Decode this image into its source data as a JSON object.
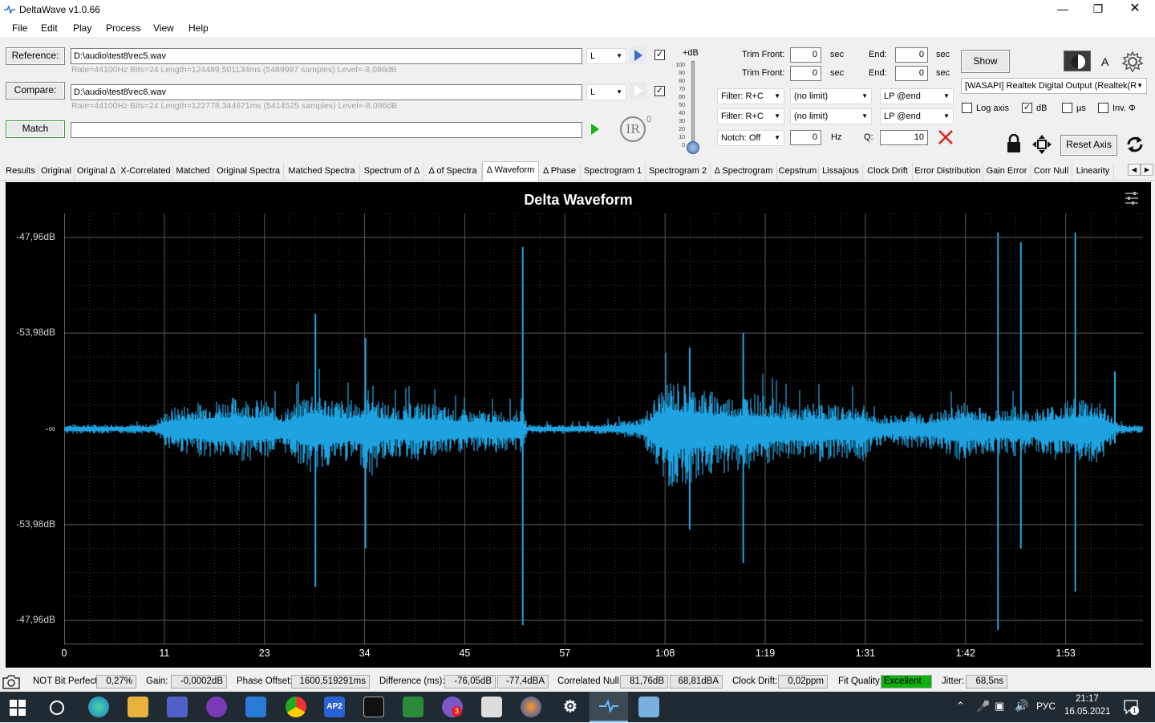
{
  "window": {
    "title": "DeltaWave v1.0.66"
  },
  "menu": [
    "File",
    "Edit",
    "Play",
    "Process",
    "View",
    "Help"
  ],
  "reference": {
    "button": "Reference:",
    "path": "D:\\audio\\test8\\rec5.wav",
    "info": "Rate=44100Hz Bits=24 Length=124489,501134ms (5489987 samples) Level=-8,086dB",
    "channel": "L"
  },
  "compare": {
    "button": "Compare:",
    "path": "D:\\audio\\test8\\rec6.wav",
    "info": "Rate=44100Hz Bits=24 Length=122778,344671ms (5414525 samples) Level=-8,086dB",
    "channel": "L"
  },
  "match": {
    "button": "Match",
    "value": ""
  },
  "ir_label": "IR",
  "ir_sup": "0",
  "level": {
    "label": "+dB",
    "ticks": [
      "100",
      "90",
      "80",
      "70",
      "60",
      "50",
      "40",
      "30",
      "20",
      "10",
      "0"
    ],
    "value": 0
  },
  "trim": {
    "front_label": "Trim Front:",
    "end_label": "End:",
    "unit": "sec",
    "ref_front": "0",
    "ref_end": "0",
    "cmp_front": "0",
    "cmp_end": "0"
  },
  "filters": {
    "filter1": "Filter: R+C",
    "limit1": "(no limit)",
    "lp1": "LP @end",
    "filter2": "Filter: R+C",
    "limit2": "(no limit)",
    "lp2": "LP @end",
    "notch": "Notch: Off",
    "notch_hz": "0",
    "hz_label": "Hz",
    "q_label": "Q:",
    "q_value": "10"
  },
  "output": {
    "show_button": "Show",
    "a_label": "A",
    "device": "[WASAPI] Realtek Digital Output (Realtek(R",
    "log_axis": {
      "label": "Log axis",
      "checked": false
    },
    "db": {
      "label": "dB",
      "checked": true
    },
    "us": {
      "label": "µs",
      "checked": false
    },
    "inv": {
      "label": "Inv. Φ",
      "checked": false
    },
    "reset_axis": "Reset Axis"
  },
  "tabs": [
    "Results",
    "Original",
    "Original Δ",
    "X-Correlated",
    "Matched",
    "Original Spectra",
    "Matched Spectra",
    "Spectrum of Δ",
    "Δ of Spectra",
    "Δ Waveform",
    "Δ Phase",
    "Spectrogram 1",
    "Spectrogram 2",
    "Δ Spectrogram",
    "Cepstrum",
    "Lissajous",
    "Clock Drift",
    "Error Distribution",
    "Gain Error",
    "Corr Null",
    "Linearity"
  ],
  "active_tab": "Δ Waveform",
  "chart_data": {
    "type": "line",
    "title": "Delta Waveform",
    "xlabel": "",
    "ylabel": "",
    "x_tick_labels": [
      "0",
      "11",
      "23",
      "34",
      "45",
      "57",
      "1:08",
      "1:19",
      "1:31",
      "1:42",
      "1:53"
    ],
    "x_ticks_seconds": [
      0,
      11.4,
      22.8,
      34.2,
      45.6,
      57,
      68.4,
      79.8,
      91.2,
      102.6,
      114
    ],
    "xlim_seconds": [
      0,
      122.8
    ],
    "y_tick_labels": [
      "-47,96dB",
      "-53,98dB",
      "-∞",
      "-53,98dB",
      "-47,96dB"
    ],
    "y_ticks_linear": [
      0.004,
      0.002,
      0,
      -0.002,
      -0.004
    ],
    "ylim_linear": [
      -0.0045,
      0.0045
    ],
    "grid": true,
    "series": [
      {
        "color": "#1fa3e0",
        "envelope_time_s": [
          0,
          5,
          10,
          11.8,
          13,
          16,
          20,
          23,
          25,
          26.5,
          28,
          29,
          30,
          32,
          34,
          35,
          36,
          38,
          40,
          43,
          46,
          48,
          50,
          52.3,
          52.7,
          53.5,
          56,
          60,
          65,
          66,
          67,
          68,
          69,
          70,
          72,
          74,
          76,
          78,
          80,
          82,
          84,
          86,
          88,
          91,
          92,
          94,
          96,
          98,
          100,
          102,
          104,
          106,
          108,
          110,
          112,
          114,
          116,
          118,
          120,
          122.8
        ],
        "envelope_upper": [
          0.0001,
          0.0001,
          0.0001,
          0.0004,
          0.0005,
          0.0006,
          0.0007,
          0.0006,
          0.0004,
          0.0006,
          0.0009,
          0.0008,
          0.0007,
          0.0006,
          0.0007,
          0.001,
          0.0006,
          0.0005,
          0.0006,
          0.0005,
          0.0004,
          0.0004,
          0.0004,
          0.0004,
          0.0001,
          0.0001,
          0.0001,
          0.0001,
          0.0002,
          0.0003,
          0.0006,
          0.0009,
          0.0011,
          0.001,
          0.0009,
          0.0008,
          0.0007,
          0.0008,
          0.0007,
          0.0006,
          0.0005,
          0.0006,
          0.0005,
          0.0006,
          0.0003,
          0.0003,
          0.0004,
          0.0003,
          0.0004,
          0.0006,
          0.0005,
          0.0004,
          0.0005,
          0.0004,
          0.0005,
          0.0006,
          0.0007,
          0.0006,
          0.0001,
          0.0001
        ],
        "envelope_lower": [
          -0.0001,
          -0.0001,
          -0.0001,
          -0.0004,
          -0.0005,
          -0.0006,
          -0.0007,
          -0.0006,
          -0.0005,
          -0.0007,
          -0.001,
          -0.0009,
          -0.0008,
          -0.0007,
          -0.0008,
          -0.0011,
          -0.0007,
          -0.0006,
          -0.0007,
          -0.0006,
          -0.0005,
          -0.0005,
          -0.0005,
          -0.0005,
          -0.0001,
          -0.0001,
          -0.0001,
          -0.0001,
          -0.0002,
          -0.0003,
          -0.0008,
          -0.0011,
          -0.0013,
          -0.0012,
          -0.0011,
          -0.001,
          -0.0009,
          -0.0009,
          -0.0008,
          -0.0007,
          -0.0006,
          -0.0007,
          -0.0006,
          -0.0007,
          -0.0004,
          -0.0003,
          -0.0004,
          -0.0004,
          -0.0005,
          -0.0007,
          -0.0006,
          -0.0005,
          -0.0006,
          -0.0005,
          -0.0006,
          -0.0007,
          -0.0008,
          -0.0007,
          -0.0001,
          -0.0001
        ],
        "spikes": [
          {
            "t": 28.6,
            "max": 0.0024,
            "min": -0.0033
          },
          {
            "t": 34.3,
            "max": 0.0019,
            "min": -0.0025
          },
          {
            "t": 52.2,
            "max": 0.0038,
            "min": -0.0041
          },
          {
            "t": 71.2,
            "max": 0.0017,
            "min": -0.0021
          },
          {
            "t": 77.3,
            "max": 0.002,
            "min": -0.0028
          },
          {
            "t": 106.3,
            "max": 0.0041,
            "min": -0.0042
          },
          {
            "t": 108.9,
            "max": 0.0039,
            "min": -0.0025
          },
          {
            "t": 115.1,
            "max": 0.0041,
            "min": -0.0034
          },
          {
            "t": 119.6,
            "max": 0.0012,
            "min": -0.0003
          }
        ]
      }
    ]
  },
  "status": {
    "bit_perfect": "NOT Bit Perfect",
    "bit_perfect_pct": "0,27%",
    "gain_label": "Gain:",
    "gain": "-0,0002dB",
    "phase_label": "Phase Offset:",
    "phase": "1600,519291ms",
    "diff_label": "Difference (ms):",
    "diff_db": "-76,05dB",
    "diff_dba": "-77,4dBA",
    "null_label": "Correlated Null:",
    "null_db": "81,76dB",
    "null_dba": "68,81dBA",
    "clock_label": "Clock Drift:",
    "clock": "0,02ppm",
    "fit_label": "Fit Quality:",
    "fit": "Excellent",
    "jitter_label": "Jitter:",
    "jitter": "68,5ns"
  },
  "taskbar": {
    "apps": [
      "start",
      "search",
      "edge",
      "explorer",
      "save",
      "tor",
      "mail",
      "chrome",
      "AP2",
      "pycharm",
      "vim",
      "viber",
      "fox",
      "sound",
      "settings",
      "deltawave",
      "paint"
    ],
    "ap2_label": "AP2",
    "viber_badge": "3",
    "lang": "РУС",
    "time": "21:17",
    "date": "16.05.2021",
    "notif_count": "1"
  }
}
